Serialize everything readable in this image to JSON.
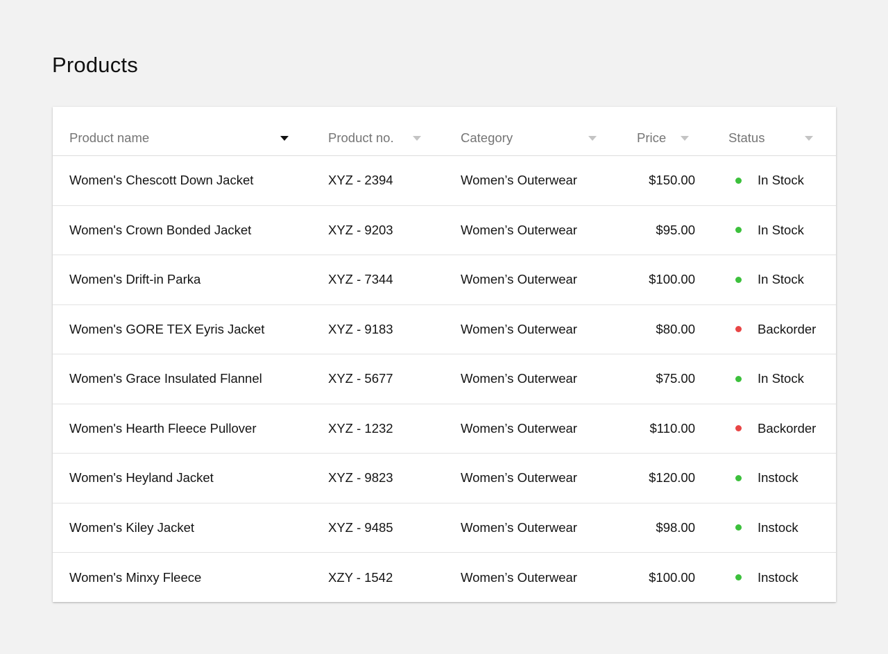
{
  "page": {
    "title": "Products"
  },
  "colors": {
    "in_stock": "#3cc03c",
    "backorder": "#e84545",
    "header_text": "#757575",
    "background": "#f2f2f2"
  },
  "table": {
    "columns": [
      {
        "key": "name",
        "label": "Product name",
        "sorted": true
      },
      {
        "key": "product_no",
        "label": "Product no.",
        "sorted": false
      },
      {
        "key": "category",
        "label": "Category",
        "sorted": false
      },
      {
        "key": "price",
        "label": "Price",
        "sorted": false
      },
      {
        "key": "status",
        "label": "Status",
        "sorted": false
      }
    ],
    "rows": [
      {
        "name": "Women's Chescott Down Jacket",
        "product_no": "XYZ - 2394",
        "category": "Women’s Outerwear",
        "price": "$150.00",
        "status": "In Stock",
        "status_kind": "in_stock"
      },
      {
        "name": "Women's Crown Bonded Jacket",
        "product_no": "XYZ - 9203",
        "category": "Women’s Outerwear",
        "price": "$95.00",
        "status": "In Stock",
        "status_kind": "in_stock"
      },
      {
        "name": "Women's Drift-in Parka",
        "product_no": "XYZ - 7344",
        "category": "Women’s Outerwear",
        "price": "$100.00",
        "status": "In Stock",
        "status_kind": "in_stock"
      },
      {
        "name": "Women's GORE TEX Eyris Jacket",
        "product_no": "XYZ - 9183",
        "category": "Women’s Outerwear",
        "price": "$80.00",
        "status": "Backorder",
        "status_kind": "backorder"
      },
      {
        "name": "Women's Grace Insulated Flannel",
        "product_no": "XYZ - 5677",
        "category": "Women’s Outerwear",
        "price": "$75.00",
        "status": "In Stock",
        "status_kind": "in_stock"
      },
      {
        "name": "Women's  Hearth Fleece Pullover",
        "product_no": "XYZ - 1232",
        "category": "Women’s Outerwear",
        "price": "$110.00",
        "status": "Backorder",
        "status_kind": "backorder"
      },
      {
        "name": "Women's Heyland Jacket",
        "product_no": "XYZ - 9823",
        "category": "Women’s Outerwear",
        "price": "$120.00",
        "status": "Instock",
        "status_kind": "in_stock"
      },
      {
        "name": "Women's Kiley Jacket",
        "product_no": "XYZ - 9485",
        "category": "Women’s Outerwear",
        "price": "$98.00",
        "status": "Instock",
        "status_kind": "in_stock"
      },
      {
        "name": "Women's Minxy Fleece",
        "product_no": "XZY - 1542",
        "category": "Women’s Outerwear",
        "price": "$100.00",
        "status": "Instock",
        "status_kind": "in_stock"
      }
    ]
  }
}
